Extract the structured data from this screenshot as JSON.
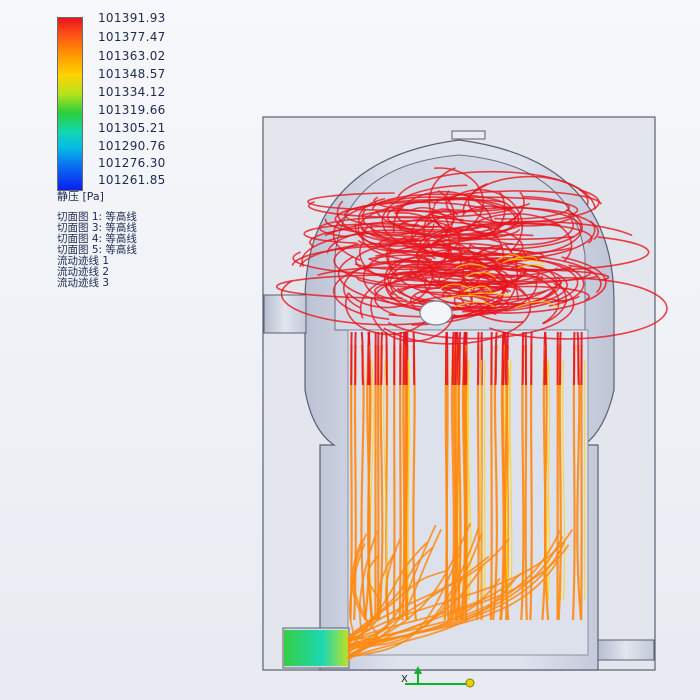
{
  "legend": {
    "ticks": [
      "101391.93",
      "101377.47",
      "101363.02",
      "101348.57",
      "101334.12",
      "101319.66",
      "101305.21",
      "101290.76",
      "101276.30",
      "101261.85"
    ],
    "units": "静压 [Pa]",
    "features": [
      "切面图 1: 等高线",
      "切面图 3: 等高线",
      "切面图 4: 等高线",
      "切面图 5: 等高线",
      "流动迹线 1",
      "流动迹线 2",
      "流动迹线 3"
    ]
  },
  "triad": {
    "x_label": "X"
  },
  "colors": {
    "high": "#e8141c",
    "mid_high": "#ff8a12",
    "mid": "#ffd200",
    "low_mid": "#2bcf3a",
    "low": "#0a1ef0"
  }
}
